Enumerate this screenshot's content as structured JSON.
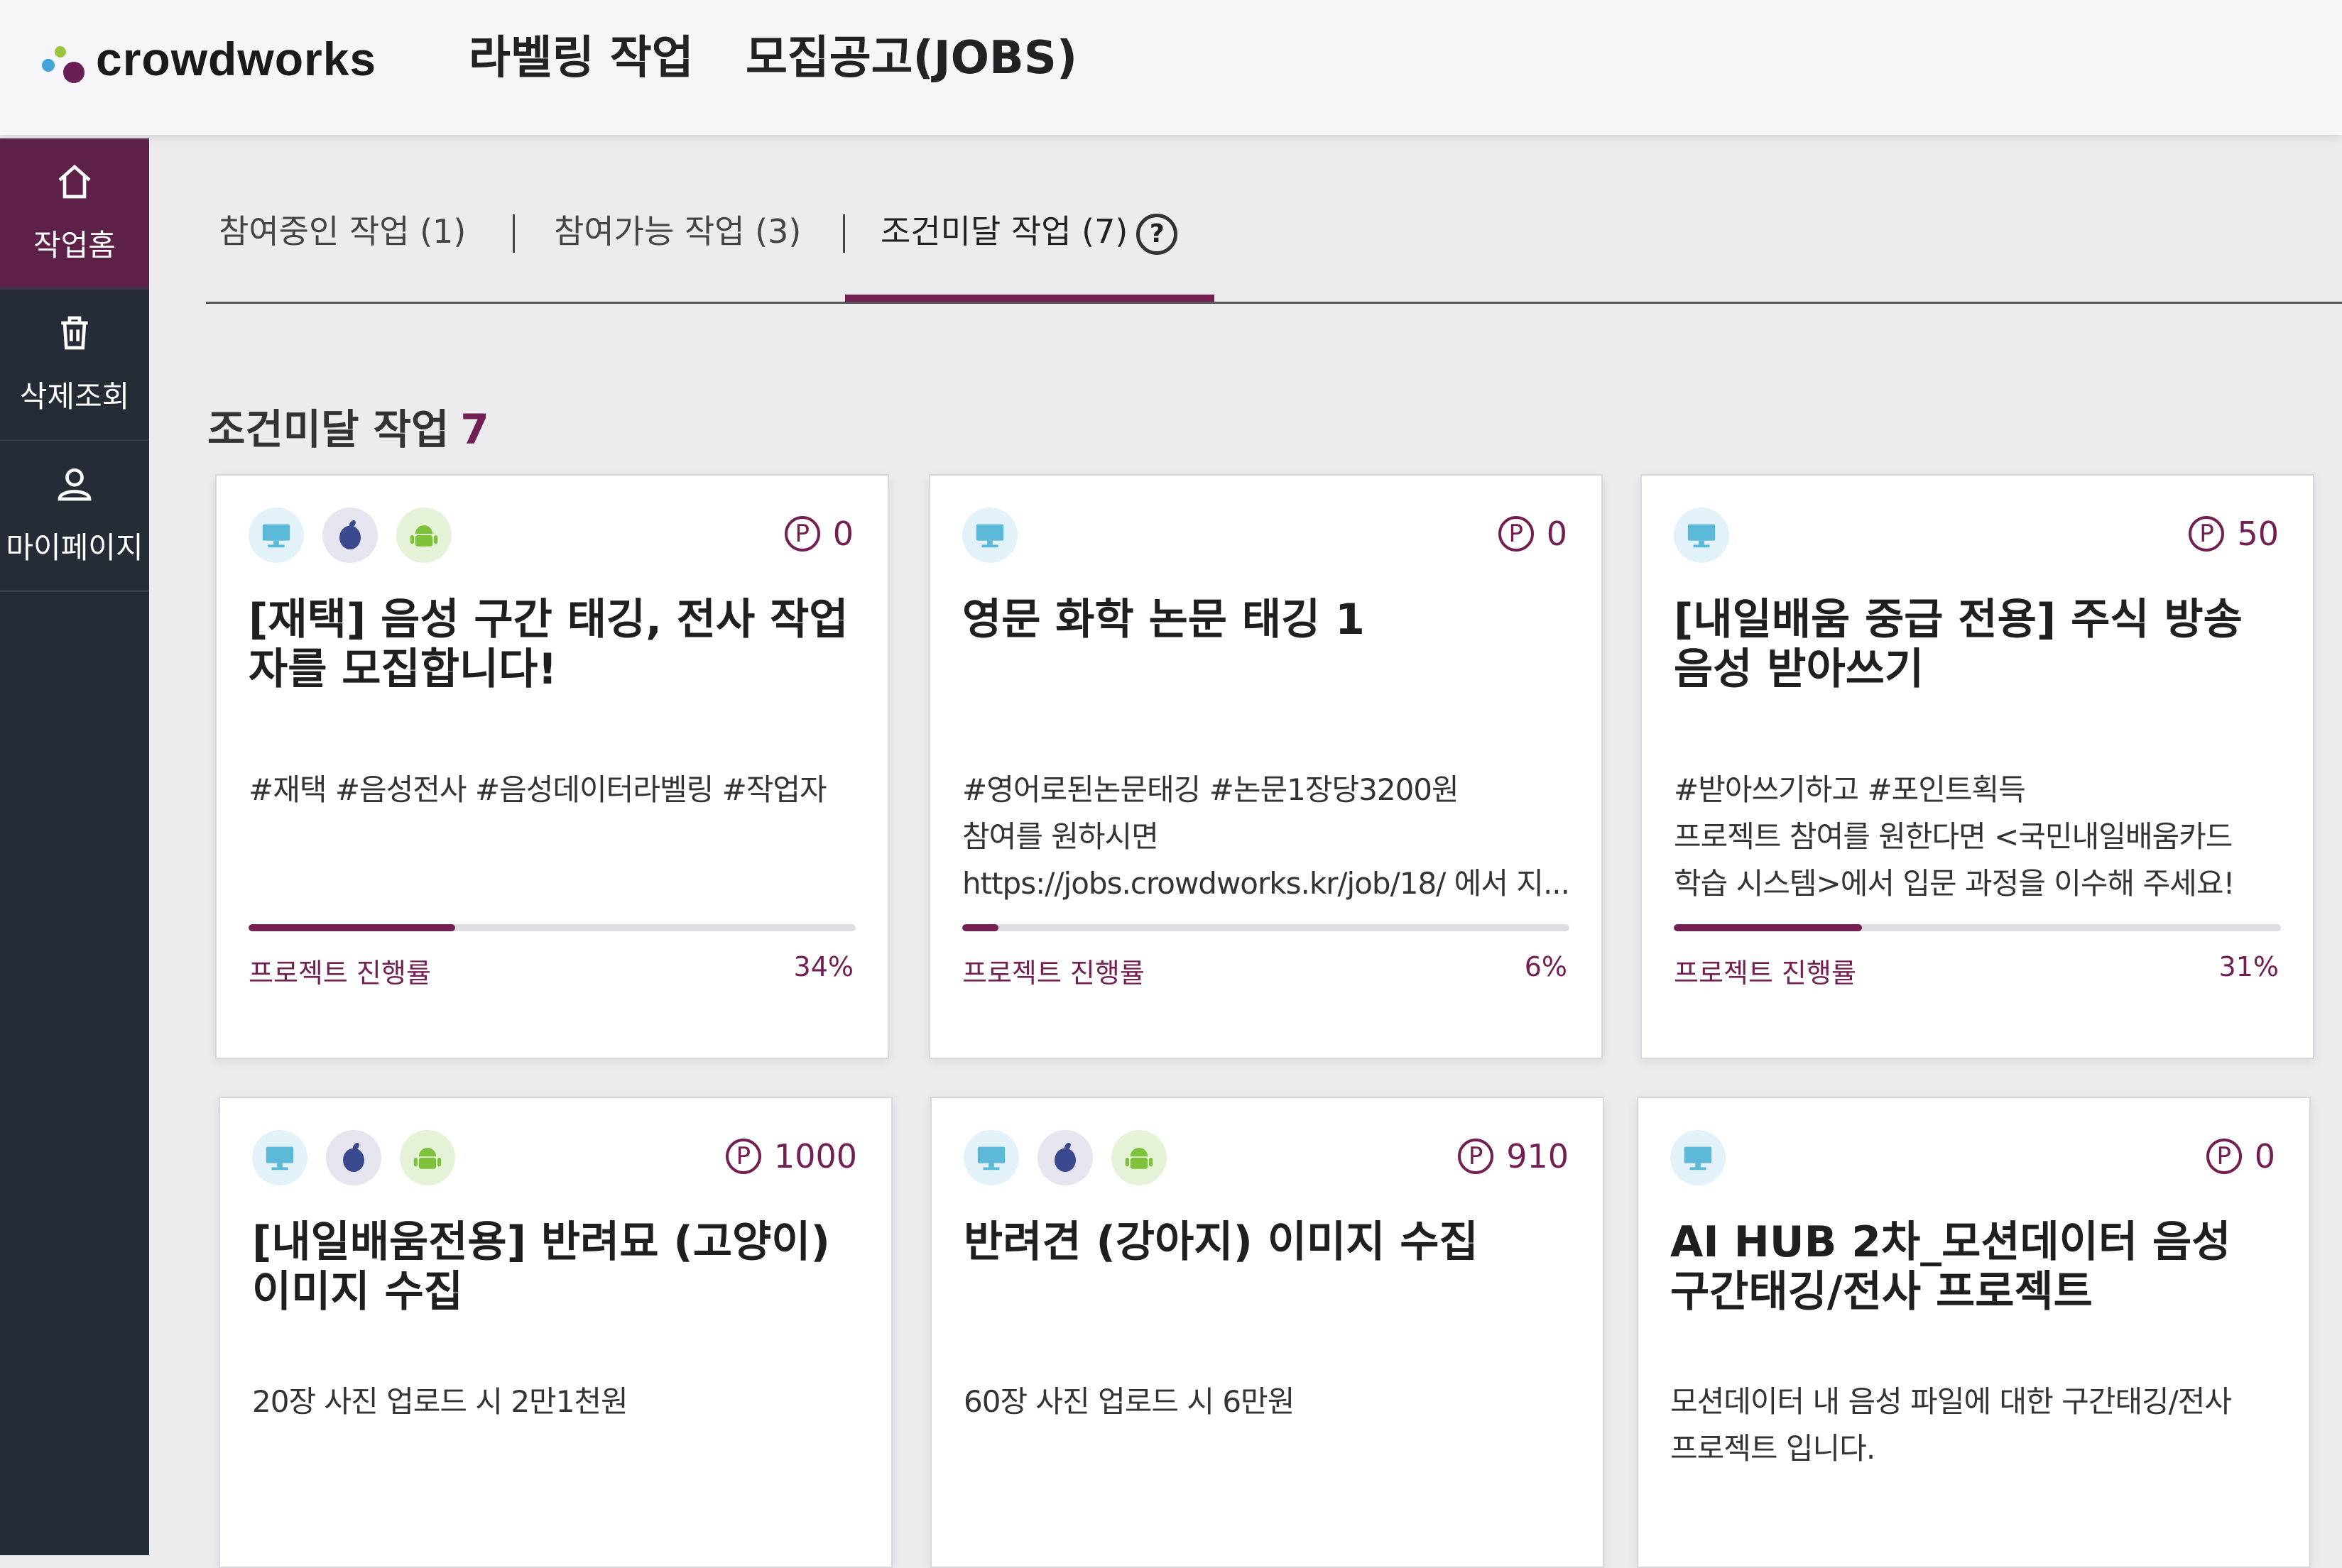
{
  "header": {
    "logo_text": "crowdworks",
    "nav": [
      "라벨링 작업",
      "모집공고(JOBS)"
    ]
  },
  "sidebar": {
    "items": [
      {
        "label": "작업홈",
        "icon": "home-icon"
      },
      {
        "label": "삭제조회",
        "icon": "trash-icon"
      },
      {
        "label": "마이페이지",
        "icon": "user-icon"
      }
    ]
  },
  "tabs": [
    {
      "label": "참여중인 작업 (1)"
    },
    {
      "label": "참여가능 작업 (3)"
    },
    {
      "label": "조건미달 작업 (7)"
    }
  ],
  "section": {
    "title": "조건미달 작업",
    "count": "7"
  },
  "cards": [
    {
      "platforms": [
        "pc",
        "ios",
        "android"
      ],
      "points": "0",
      "title": "[재택] 음성 구간 태깅, 전사 작업자를 모집합니다!",
      "desc": [
        "#재택 #음성전사 #음성데이터라벨링 #작업자"
      ],
      "progress_label": "프로젝트 진행률",
      "progress_text": "34%",
      "progress": 34
    },
    {
      "platforms": [
        "pc"
      ],
      "points": "0",
      "title": "영문 화학 논문 태깅 1",
      "desc": [
        "#영어로된논문태깅 #논문1장당3200원",
        "참여를 원하시면",
        "https://jobs.crowdworks.kr/job/18/ 에서 지..."
      ],
      "progress_label": "프로젝트 진행률",
      "progress_text": "6%",
      "progress": 6
    },
    {
      "platforms": [
        "pc"
      ],
      "points": "50",
      "title": "[내일배움 중급 전용] 주식 방송 음성 받아쓰기",
      "desc": [
        "#받아쓰기하고 #포인트획득",
        "프로젝트 참여를 원한다면 <국민내일배움카드",
        "학습 시스템>에서 입문 과정을 이수해 주세요!"
      ],
      "progress_label": "프로젝트 진행률",
      "progress_text": "31%",
      "progress": 31
    },
    {
      "platforms": [
        "pc",
        "ios",
        "android"
      ],
      "points": "1000",
      "title": "[내일배움전용] 반려묘 (고양이) 이미지 수집",
      "desc": [
        "20장 사진 업로드 시 2만1천원"
      ]
    },
    {
      "platforms": [
        "pc",
        "ios",
        "android"
      ],
      "points": "910",
      "title": "반려견 (강아지) 이미지 수집",
      "desc": [
        "60장 사진 업로드 시 6만원"
      ]
    },
    {
      "platforms": [
        "pc"
      ],
      "points": "0",
      "title": "AI HUB 2차_모션데이터 음성 구간태깅/전사 프로젝트",
      "desc": [
        "모션데이터 내 음성 파일에 대한 구간태깅/전사",
        "프로젝트 입니다."
      ]
    }
  ],
  "colors": {
    "accent": "#731f52",
    "sidebar_bg": "#262c36",
    "sidebar_active": "#5d2148"
  }
}
